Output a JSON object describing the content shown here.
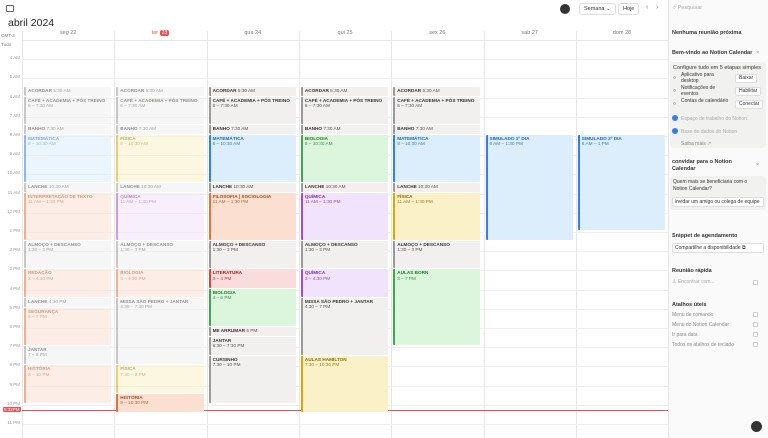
{
  "header": {
    "month": "abril",
    "year": "2024",
    "view": "Semana",
    "today": "Hoje"
  },
  "grid_labels": {
    "gmt": "GMT-3",
    "allday": "Tudo"
  },
  "days": [
    {
      "label": "seg 22"
    },
    {
      "label": "ter",
      "num": "23"
    },
    {
      "label": "qua 24"
    },
    {
      "label": "qui 25"
    },
    {
      "label": "sex 26"
    },
    {
      "label": "sab 27"
    },
    {
      "label": "dom 28"
    }
  ],
  "hours": [
    "4 AM",
    "5 AM",
    "6 AM",
    "7 AM",
    "8 AM",
    "9 AM",
    "10 AM",
    "11 AM",
    "12 PM",
    "1 PM",
    "2 PM",
    "3 PM",
    "4 PM",
    "5 PM",
    "6 PM",
    "7 PM",
    "8 PM",
    "9 PM",
    "10 PM",
    "11 PM"
  ],
  "now": "9:32PM",
  "events": [
    {
      "day": 0,
      "st": 5.5,
      "en": 6.0,
      "t": "ACORDAR",
      "s": "5:30 AM",
      "c": "gray",
      "faded": true
    },
    {
      "day": 0,
      "st": 6.0,
      "en": 7.5,
      "t": "CAFÉ + ACADEMIA + PÓS TREINO",
      "s": "6 – 7:30 AM",
      "c": "gray",
      "faded": true
    },
    {
      "day": 0,
      "st": 7.5,
      "en": 8.0,
      "t": "BANHO",
      "s": "7:30 AM",
      "c": "gray",
      "faded": true
    },
    {
      "day": 0,
      "st": 8.0,
      "en": 10.5,
      "t": "MATEMÁTICA",
      "s": "8 – 10:30 AM",
      "c": "blue",
      "faded": true
    },
    {
      "day": 0,
      "st": 10.5,
      "en": 11.0,
      "t": "LANCHE",
      "s": "10:30 AM",
      "c": "gray",
      "faded": true
    },
    {
      "day": 0,
      "st": 11.0,
      "en": 13.5,
      "t": "INTERPRETAÇÃO DE TEXTO",
      "s": "11 AM – 1:30 PM",
      "c": "orange",
      "faded": true
    },
    {
      "day": 0,
      "st": 13.5,
      "en": 15.0,
      "t": "ALMOÇO + DESCANSO",
      "s": "1:30 – 3 PM",
      "c": "gray",
      "faded": true
    },
    {
      "day": 0,
      "st": 15.0,
      "en": 16.5,
      "t": "REDAÇÃO",
      "s": "3 – 4:30 PM",
      "c": "orange",
      "faded": true
    },
    {
      "day": 0,
      "st": 16.5,
      "en": 17.0,
      "t": "LANCHE",
      "s": "4:30 PM",
      "c": "gray",
      "faded": true
    },
    {
      "day": 0,
      "st": 17.0,
      "en": 19.0,
      "t": "SEGURANÇA",
      "s": "5 – 7 PM",
      "c": "orange",
      "faded": true
    },
    {
      "day": 0,
      "st": 19.0,
      "en": 20.0,
      "t": "JANTAR",
      "s": "7 – 8 PM",
      "c": "gray",
      "faded": true
    },
    {
      "day": 0,
      "st": 20.0,
      "en": 22.0,
      "t": "HISTÓRIA",
      "s": "8 – 10 PM",
      "c": "orange",
      "faded": true
    },
    {
      "day": 1,
      "st": 5.5,
      "en": 6.0,
      "t": "ACORDAR",
      "s": "5:30 AM",
      "c": "gray",
      "faded": true
    },
    {
      "day": 1,
      "st": 6.0,
      "en": 7.5,
      "t": "CAFÉ + ACADEMIA + PÓS TREINO",
      "s": "6 – 7:30 AM",
      "c": "gray",
      "faded": true
    },
    {
      "day": 1,
      "st": 7.5,
      "en": 8.0,
      "t": "BANHO",
      "s": "7:30 AM",
      "c": "gray",
      "faded": true
    },
    {
      "day": 1,
      "st": 8.0,
      "en": 10.5,
      "t": "FÍSICA",
      "s": "8 – 10:30 AM",
      "c": "yellow",
      "faded": true
    },
    {
      "day": 1,
      "st": 10.5,
      "en": 11.0,
      "t": "LANCHE",
      "s": "10:30 AM",
      "c": "gray",
      "faded": true
    },
    {
      "day": 1,
      "st": 11.0,
      "en": 13.5,
      "t": "QUÍMICA",
      "s": "11 AM – 1:30 PM",
      "c": "purple",
      "faded": true
    },
    {
      "day": 1,
      "st": 13.5,
      "en": 15.0,
      "t": "ALMOÇO + DESCANSO",
      "s": "1:30 – 3 PM",
      "c": "gray",
      "faded": true
    },
    {
      "day": 1,
      "st": 15.0,
      "en": 16.5,
      "t": "BIOLOGIA",
      "s": "3 – 4:30 PM",
      "c": "orange",
      "faded": true
    },
    {
      "day": 1,
      "st": 16.5,
      "en": 20.0,
      "t": "MISSA SÃO PEDRO + JANTAR",
      "s": "4:30 – 7:30 PM",
      "c": "gray",
      "faded": true
    },
    {
      "day": 1,
      "st": 20.0,
      "en": 21.5,
      "t": "FÍSICA",
      "s": "7:30 – 9 PM",
      "c": "yellow",
      "faded": true
    },
    {
      "day": 1,
      "st": 21.5,
      "en": 22.5,
      "t": "HISTÓRIA",
      "s": "9 – 10:30 PM",
      "c": "orange",
      "faded": false
    },
    {
      "day": 2,
      "st": 5.5,
      "en": 6.0,
      "t": "ACORDAR",
      "s": "5:30 AM",
      "c": "gray",
      "faded": false
    },
    {
      "day": 2,
      "st": 6.0,
      "en": 7.5,
      "t": "CAFÉ + ACADEMIA + PÓS TREINO",
      "s": "6 – 7:30 AM",
      "c": "gray",
      "faded": false
    },
    {
      "day": 2,
      "st": 7.5,
      "en": 8.0,
      "t": "BANHO",
      "s": "7:30 AM",
      "c": "gray",
      "faded": false
    },
    {
      "day": 2,
      "st": 8.0,
      "en": 10.5,
      "t": "MATEMÁTICA",
      "s": "8 – 10:30 AM",
      "c": "blue",
      "faded": false
    },
    {
      "day": 2,
      "st": 10.5,
      "en": 11.0,
      "t": "LANCHE",
      "s": "10:30 AM",
      "c": "gray",
      "faded": false
    },
    {
      "day": 2,
      "st": 11.0,
      "en": 13.5,
      "t": "FILOSOFIA | SOCIOLOGIA",
      "s": "11 AM – 1:30 PM",
      "c": "orange",
      "faded": false
    },
    {
      "day": 2,
      "st": 13.5,
      "en": 15.0,
      "t": "ALMOÇO + DESCANSO",
      "s": "1:30 – 3 PM",
      "c": "gray",
      "faded": false
    },
    {
      "day": 2,
      "st": 15.0,
      "en": 16.0,
      "t": "LITERATURA",
      "s": "3 – 4 PM",
      "c": "red",
      "faded": false
    },
    {
      "day": 2,
      "st": 16.0,
      "en": 18.0,
      "t": "BIOLOGIA",
      "s": "4 – 6 PM",
      "c": "green",
      "faded": false
    },
    {
      "day": 2,
      "st": 18.0,
      "en": 18.5,
      "t": "ME ARRUMAR",
      "s": "6 PM",
      "c": "gray",
      "faded": false
    },
    {
      "day": 2,
      "st": 18.5,
      "en": 19.5,
      "t": "JANTAR",
      "s": "6:30 – 7:30 PM",
      "c": "gray",
      "faded": false
    },
    {
      "day": 2,
      "st": 19.5,
      "en": 22.0,
      "t": "CURSINHO",
      "s": "7:30 – 10 PM",
      "c": "gray",
      "faded": false
    },
    {
      "day": 3,
      "st": 5.5,
      "en": 6.0,
      "t": "ACORDAR",
      "s": "5:30 AM",
      "c": "gray",
      "faded": false
    },
    {
      "day": 3,
      "st": 6.0,
      "en": 7.5,
      "t": "CAFÉ + ACADEMIA + PÓS TREINO",
      "s": "6 – 7:30 AM",
      "c": "gray",
      "faded": false
    },
    {
      "day": 3,
      "st": 7.5,
      "en": 8.0,
      "t": "BANHO",
      "s": "7:30 AM",
      "c": "gray",
      "faded": false
    },
    {
      "day": 3,
      "st": 8.0,
      "en": 10.5,
      "t": "BIOLOGIA",
      "s": "8 – 10:30 AM",
      "c": "green",
      "faded": false
    },
    {
      "day": 3,
      "st": 10.5,
      "en": 11.0,
      "t": "LANCHE",
      "s": "10:30 AM",
      "c": "gray",
      "faded": false
    },
    {
      "day": 3,
      "st": 11.0,
      "en": 13.5,
      "t": "QUÍMICA",
      "s": "11 AM – 1:30 PM",
      "c": "purple",
      "faded": false
    },
    {
      "day": 3,
      "st": 13.5,
      "en": 15.0,
      "t": "ALMOÇO + DESCANSO",
      "s": "1:30 – 3 PM",
      "c": "gray",
      "faded": false
    },
    {
      "day": 3,
      "st": 15.0,
      "en": 16.5,
      "t": "QUÍMICA",
      "s": "3 – 4:30 PM",
      "c": "purple",
      "faded": false
    },
    {
      "day": 3,
      "st": 16.5,
      "en": 19.5,
      "t": "MISSA SÃO PEDRO + JANTAR",
      "s": "4:30 – 7 PM",
      "c": "gray",
      "faded": false
    },
    {
      "day": 3,
      "st": 19.5,
      "en": 22.5,
      "t": "AULAS HAMILTON",
      "s": "7:30 – 10:30 PM",
      "c": "yellow",
      "faded": false
    },
    {
      "day": 4,
      "st": 5.5,
      "en": 6.0,
      "t": "ACORDAR",
      "s": "5:30 AM",
      "c": "gray",
      "faded": false
    },
    {
      "day": 4,
      "st": 6.0,
      "en": 7.5,
      "t": "CAFÉ + ACADEMIA + PÓS TREINO",
      "s": "6 – 7:30 AM",
      "c": "gray",
      "faded": false
    },
    {
      "day": 4,
      "st": 7.5,
      "en": 8.0,
      "t": "BANHO",
      "s": "7:30 AM",
      "c": "gray",
      "faded": false
    },
    {
      "day": 4,
      "st": 8.0,
      "en": 10.5,
      "t": "MATEMÁTICA",
      "s": "8 – 10:30 AM",
      "c": "blue",
      "faded": false
    },
    {
      "day": 4,
      "st": 10.5,
      "en": 11.0,
      "t": "LANCHE",
      "s": "10:30 AM",
      "c": "gray",
      "faded": false
    },
    {
      "day": 4,
      "st": 11.0,
      "en": 13.5,
      "t": "FÍSICA",
      "s": "11 AM – 1:30 PM",
      "c": "yellow",
      "faded": false
    },
    {
      "day": 4,
      "st": 13.5,
      "en": 15.0,
      "t": "ALMOÇO + DESCANSO",
      "s": "1:30 – 3 PM",
      "c": "gray",
      "faded": false
    },
    {
      "day": 4,
      "st": 15.0,
      "en": 19.0,
      "t": "AULAS BORN",
      "s": "3 – 7 PM",
      "c": "green",
      "faded": false
    },
    {
      "day": 5,
      "st": 8.0,
      "en": 13.5,
      "t": "SIMULADO 1º DIA",
      "s": "8 AM – 1:30 PM",
      "c": "blue",
      "faded": false
    },
    {
      "day": 6,
      "st": 8.0,
      "en": 13.0,
      "t": "SIMULADO 2º DIA",
      "s": "8 AM – 1 PM",
      "c": "blue",
      "faded": false
    }
  ],
  "colors": {
    "gray": {
      "bg": "#f1f0ef",
      "bd": "#9b9a97",
      "fg": "#37352f"
    },
    "blue": {
      "bg": "#dceefc",
      "bd": "#2f80ed",
      "fg": "#1a63b8"
    },
    "yellow": {
      "bg": "#fbf1c9",
      "bd": "#e0a600",
      "fg": "#8a6600"
    },
    "purple": {
      "bg": "#f1e3fb",
      "bd": "#a64bd8",
      "fg": "#7d2ea8"
    },
    "orange": {
      "bg": "#fbe0d2",
      "bd": "#e2733a",
      "fg": "#a34a1c"
    },
    "red": {
      "bg": "#fbdcdc",
      "bd": "#d9453d",
      "fg": "#a3231c"
    },
    "green": {
      "bg": "#dcf5dd",
      "bd": "#3aaa4a",
      "fg": "#1f7a2c"
    }
  },
  "panel": {
    "search": "Pesquisar",
    "next_meeting": "Nenhuma reunião próxima",
    "welcome_title": "Bem-vindo ao Notion Calendar",
    "setup_label": "Configure tudo em 5 etapas simples",
    "steps": [
      {
        "label": "Aplicativo para desktop",
        "action": "Baixar"
      },
      {
        "label": "Notificações de eventos",
        "action": "Habilitar"
      },
      {
        "label": "Contas de calendário",
        "action": "Conectar"
      }
    ],
    "done": [
      "Espaço de trabalho do Notion",
      "Base de dados do Notion"
    ],
    "learn_more": "Saiba mais",
    "invite_title": "convidar para o Notion Calendar",
    "invite_question": "Quem mais se beneficiaria com o Notion Calendar?",
    "invite_input": "invidar um amigo ou colega de equipe",
    "snippet_title": "Snippet de agendamento",
    "snippet_btn": "Compartilhe a disponibilidade",
    "quick_title": "Reunião rápida",
    "quick_input": "Encontrar com...",
    "shortcuts_title": "Atalhos úteis",
    "shortcuts": [
      "Menu de comando",
      "Menu do Notion Calendar",
      "Ir para data",
      "Todos os atalhos de teclado"
    ]
  }
}
